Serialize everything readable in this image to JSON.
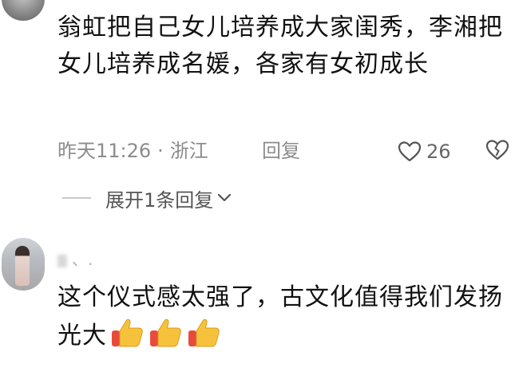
{
  "comments": [
    {
      "text": "翁虹把自己女儿培养成大家闺秀，李湘把女儿培养成名媛，各家有女初成长",
      "time": "昨天11:26",
      "separator": "·",
      "location": "浙江",
      "reply_label": "回复",
      "like_count": "26",
      "expand_label": "展开1条回复"
    },
    {
      "username": "、.",
      "text": "这个仪式感太强了，古文化值得我们发扬光大",
      "emojis": [
        "thumbs-up",
        "thumbs-up",
        "thumbs-up"
      ]
    }
  ],
  "colors": {
    "meta_gray": "#8c8c8c",
    "emoji_yellow": "#f7c23b",
    "emoji_red": "#e84b3c"
  }
}
